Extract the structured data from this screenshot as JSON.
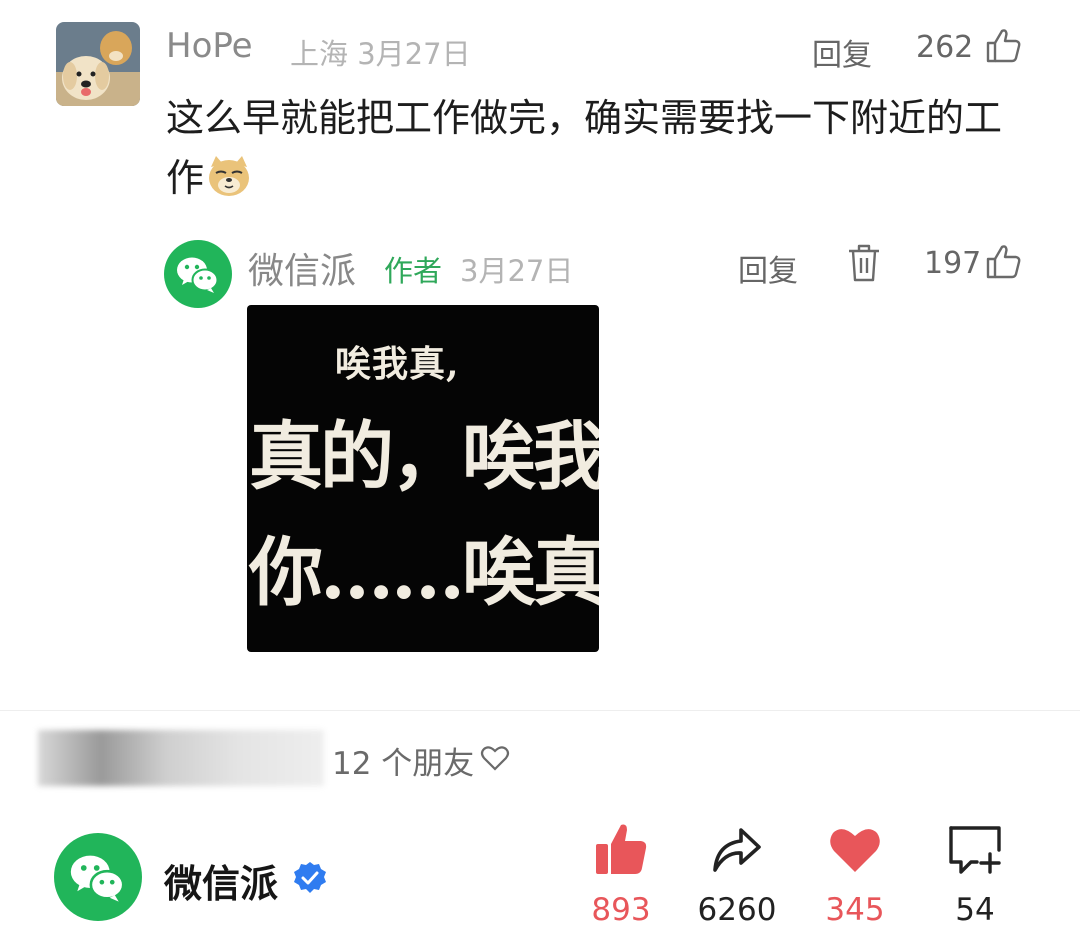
{
  "comment": {
    "user": "HoPe",
    "location": "上海",
    "date": "3月27日",
    "reply_label": "回复",
    "like_count": "262",
    "text": "这么早就能把工作做完，确实需要找一下附近的工作"
  },
  "reply": {
    "user": "微信派",
    "author_tag": "作者",
    "date": "3月27日",
    "reply_label": "回复",
    "like_count": "197",
    "meme": {
      "line1": "唉我真,",
      "line2": "真的，唉我,",
      "line3": "你……唉真是"
    }
  },
  "friends": {
    "text": "12 个朋友"
  },
  "bottom_bar": {
    "account_name": "微信派",
    "like_count": "893",
    "share_count": "6260",
    "heart_count": "345",
    "comment_count": "54"
  },
  "colors": {
    "wechat_green": "#21b55a",
    "author_green": "#2fa85a",
    "like_red": "#e8565a",
    "verified_blue": "#2f7cf0"
  }
}
